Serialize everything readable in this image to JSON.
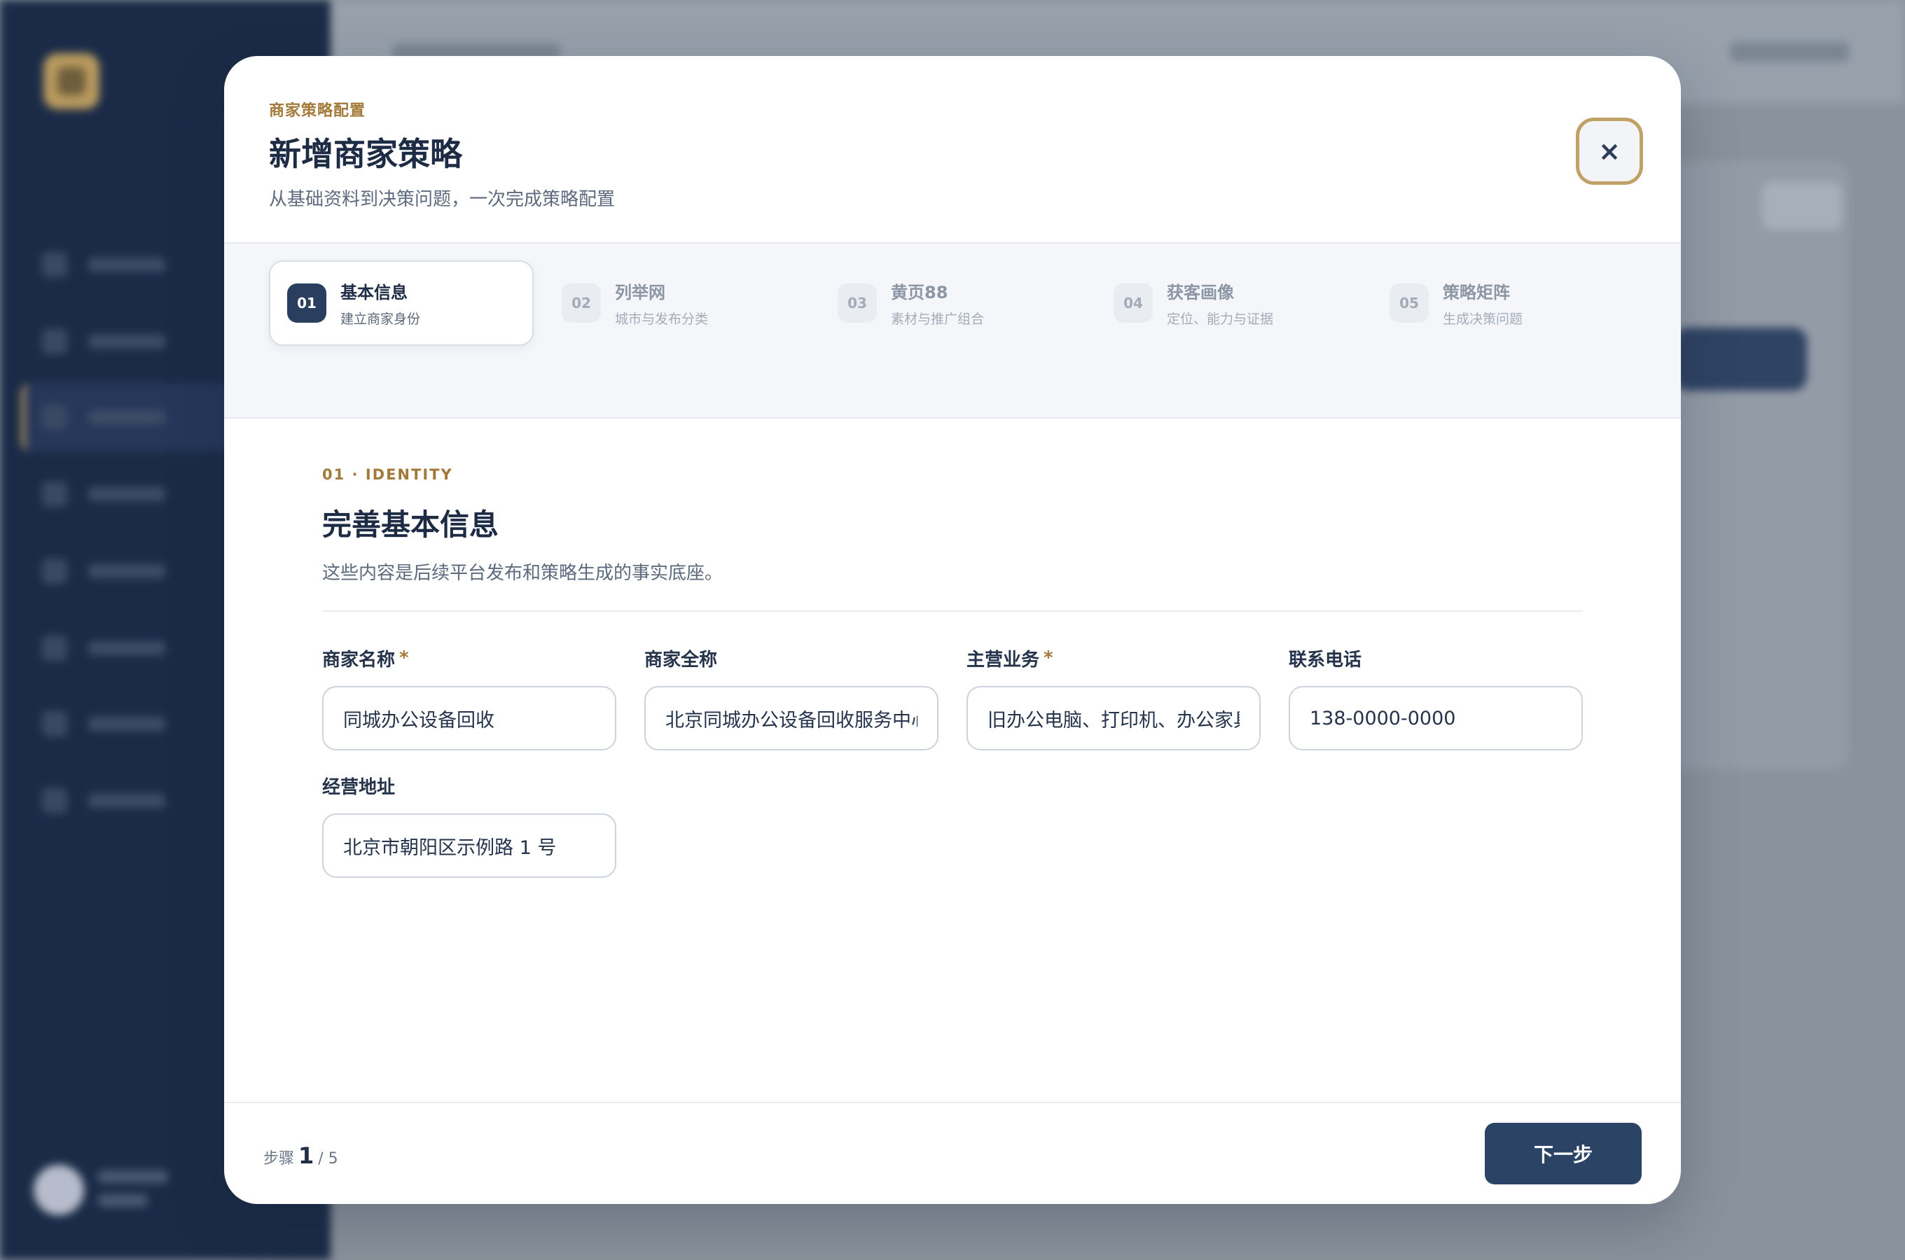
{
  "modal": {
    "eyebrow": "商家策略配置",
    "title": "新增商家策略",
    "subtitle": "从基础资料到决策问题，一次完成策略配置",
    "close_label": "×"
  },
  "stepper": {
    "steps": [
      {
        "num": "01",
        "label": "基本信息",
        "desc": "建立商家身份",
        "active": true
      },
      {
        "num": "02",
        "label": "列举网",
        "desc": "城市与发布分类",
        "active": false
      },
      {
        "num": "03",
        "label": "黄页88",
        "desc": "素材与推广组合",
        "active": false
      },
      {
        "num": "04",
        "label": "获客画像",
        "desc": "定位、能力与证据",
        "active": false
      },
      {
        "num": "05",
        "label": "策略矩阵",
        "desc": "生成决策问题",
        "active": false
      }
    ]
  },
  "section": {
    "eyebrow": "01 · IDENTITY",
    "title": "完善基本信息",
    "description": "这些内容是后续平台发布和策略生成的事实底座。"
  },
  "form": {
    "required_mark": "*",
    "fields": [
      {
        "label": "商家名称",
        "required": true,
        "value": "同城办公设备回收"
      },
      {
        "label": "商家全称",
        "required": false,
        "value": "北京同城办公设备回收服务中心"
      },
      {
        "label": "主营业务",
        "required": true,
        "value": "旧办公电脑、打印机、办公家具"
      },
      {
        "label": "联系电话",
        "required": false,
        "value": "138-0000-0000"
      },
      {
        "label": "经营地址",
        "required": false,
        "value": "北京市朝阳区示例路 1 号"
      }
    ]
  },
  "footer": {
    "step_prefix": "步骤",
    "current_step": "1",
    "total_steps": "/ 5",
    "next_label": "下一步"
  },
  "colors": {
    "accent_gold": "#a3793a",
    "primary_navy": "#2b4466",
    "sidebar_bg": "#1b2b47"
  }
}
